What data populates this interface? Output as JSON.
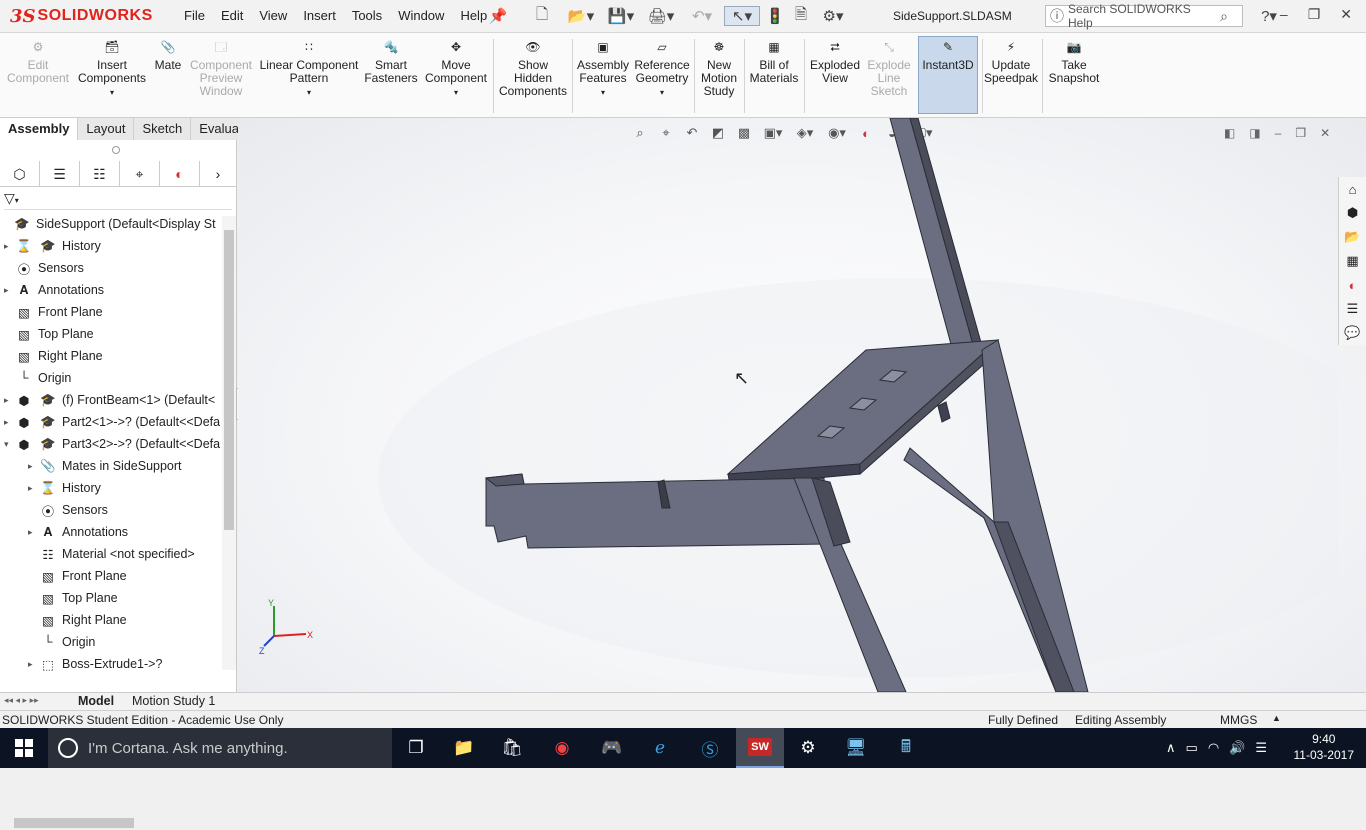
{
  "app": {
    "brand": "SOLIDWORKS",
    "doc_title": "SideSupport.SLDASM",
    "search_placeholder": "Search SOLIDWORKS Help"
  },
  "menus": [
    "File",
    "Edit",
    "View",
    "Insert",
    "Tools",
    "Window",
    "Help"
  ],
  "commands": [
    {
      "id": "edit-component",
      "label": "Edit Component",
      "enabled": false
    },
    {
      "id": "insert-components",
      "label": "Insert Components",
      "enabled": true
    },
    {
      "id": "mate",
      "label": "Mate",
      "enabled": true
    },
    {
      "id": "component-preview-window",
      "label": "Component Preview Window",
      "enabled": false
    },
    {
      "id": "linear-component-pattern",
      "label": "Linear Component Pattern",
      "enabled": true
    },
    {
      "id": "smart-fasteners",
      "label": "Smart Fasteners",
      "enabled": true
    },
    {
      "id": "move-component",
      "label": "Move Component",
      "enabled": true
    },
    {
      "id": "show-hidden-components",
      "label": "Show Hidden Components",
      "enabled": true
    },
    {
      "id": "assembly-features",
      "label": "Assembly Features",
      "enabled": true
    },
    {
      "id": "reference-geometry",
      "label": "Reference Geometry",
      "enabled": true
    },
    {
      "id": "new-motion-study",
      "label": "New Motion Study",
      "enabled": true
    },
    {
      "id": "bill-of-materials",
      "label": "Bill of Materials",
      "enabled": true
    },
    {
      "id": "exploded-view",
      "label": "Exploded View",
      "enabled": true
    },
    {
      "id": "explode-line-sketch",
      "label": "Explode Line Sketch",
      "enabled": false
    },
    {
      "id": "instant3d",
      "label": "Instant3D",
      "enabled": true,
      "active": true
    },
    {
      "id": "update-speedpak",
      "label": "Update Speedpak",
      "enabled": true
    },
    {
      "id": "take-snapshot",
      "label": "Take Snapshot",
      "enabled": true
    }
  ],
  "tabs": [
    "Assembly",
    "Layout",
    "Sketch",
    "Evaluate"
  ],
  "tree": [
    {
      "label": "SideSupport  (Default<Display St",
      "icon": "assembly-icon"
    },
    {
      "label": "History",
      "icon": "history-icon"
    },
    {
      "label": "Sensors",
      "icon": "sensor-icon"
    },
    {
      "label": "Annotations",
      "icon": "annotation-icon"
    },
    {
      "label": "Front Plane",
      "icon": "plane-icon"
    },
    {
      "label": "Top Plane",
      "icon": "plane-icon"
    },
    {
      "label": "Right Plane",
      "icon": "plane-icon"
    },
    {
      "label": "Origin",
      "icon": "origin-icon"
    },
    {
      "label": "(f) FrontBeam<1> (Default<",
      "icon": "part-icon"
    },
    {
      "label": "Part2<1>->? (Default<<Defa",
      "icon": "part-icon"
    },
    {
      "label": "Part3<2>->? (Default<<Defa",
      "icon": "part-icon"
    },
    {
      "label": "Mates in SideSupport",
      "icon": "mates-icon"
    },
    {
      "label": "History",
      "icon": "history-icon"
    },
    {
      "label": "Sensors",
      "icon": "sensor-icon"
    },
    {
      "label": "Annotations",
      "icon": "annotation-icon"
    },
    {
      "label": "Material <not specified>",
      "icon": "material-icon"
    },
    {
      "label": "Front Plane",
      "icon": "plane-icon"
    },
    {
      "label": "Top Plane",
      "icon": "plane-icon"
    },
    {
      "label": "Right Plane",
      "icon": "plane-icon"
    },
    {
      "label": "Origin",
      "icon": "origin-icon"
    },
    {
      "label": "Boss-Extrude1->?",
      "icon": "extrude-icon"
    }
  ],
  "bottom_tabs": [
    "Model",
    "Motion Study 1"
  ],
  "status": {
    "edition": "SOLIDWORKS Student Edition - Academic Use Only",
    "state": "Fully Defined",
    "mode": "Editing Assembly",
    "units": "MMGS"
  },
  "taskbar": {
    "cortana": "I'm Cortana. Ask me anything.",
    "time": "9:40",
    "date": "11-03-2017"
  },
  "triad": {
    "x": "X",
    "y": "Y",
    "z": "Z"
  },
  "colors": {
    "brand": "#e2231a",
    "part_fill": "#6b6e80",
    "active_button": "#c9d8ea"
  }
}
